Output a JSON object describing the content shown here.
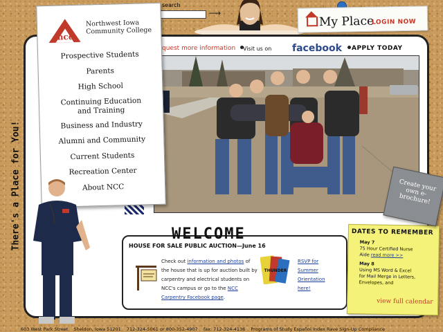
{
  "search": {
    "label": "search",
    "placeholder": ""
  },
  "my_place": {
    "title": "My Place",
    "login": "LOGIN NOW"
  },
  "topbar": {
    "request": "request more information",
    "visit": "Visit us on",
    "facebook": "facebook",
    "apply": "APPLY TODAY"
  },
  "college": {
    "name_line1": "Northwest Iowa",
    "name_line2": "Community College"
  },
  "nav": {
    "items": [
      {
        "label": "Prospective Students"
      },
      {
        "label": "Parents"
      },
      {
        "label": "High School"
      },
      {
        "label": "Continuing Education"
      },
      {
        "label": "and Training"
      },
      {
        "label": "Business and Industry"
      },
      {
        "label": "Alumni and Community"
      },
      {
        "label": "Current Students"
      },
      {
        "label": "Recreation Center"
      },
      {
        "label": "About NCC"
      }
    ]
  },
  "side_text": "There's a Place for You!",
  "welcome": {
    "title": "WELCOME",
    "house_title": "HOUSE FOR SALE PUBLIC AUCTION—June 16",
    "text_1": "Check out",
    "link_1": "information and photos",
    "text_2": "of the house that is up for auction built by carpentry and electrical students on NCC's campus or go to the",
    "link_2": "NCC Carpentry Facebook page",
    "text_3": ".",
    "rsvp_1": "RSVP for",
    "rsvp_2": "Summer",
    "rsvp_3": "Orientation",
    "rsvp_4": "here!",
    "logo_text": "THUNDER"
  },
  "dates": {
    "title": "DATES TO REMEMBER",
    "events": [
      {
        "date": "May 7",
        "line1": "75 Hour Certified Nurse",
        "line2": "Aide",
        "more": "read more >>"
      },
      {
        "date": "May 8",
        "line1": "Using MS Word & Excel",
        "line2": "for Mail Merge in Letters,",
        "line3": "Envelopes, and"
      }
    ],
    "view_calendar": "view full calendar"
  },
  "brochure": "Create your own e-brochure!",
  "footer": {
    "address": "603 West Park Street",
    "city": "Sheldon, Iowa 51201",
    "phone": "712-324-5061 or 800-352-4907",
    "fax": "fax: 712-324-4136",
    "links": [
      "Programs of Study",
      "Español Index",
      "Rave Sign-Up",
      "Compliance"
    ]
  },
  "colors": {
    "accent_red": "#c0392b",
    "facebook_blue": "#2c4a8a",
    "link_blue": "#1a3e9c",
    "sticky_yellow": "#f5f27a"
  }
}
